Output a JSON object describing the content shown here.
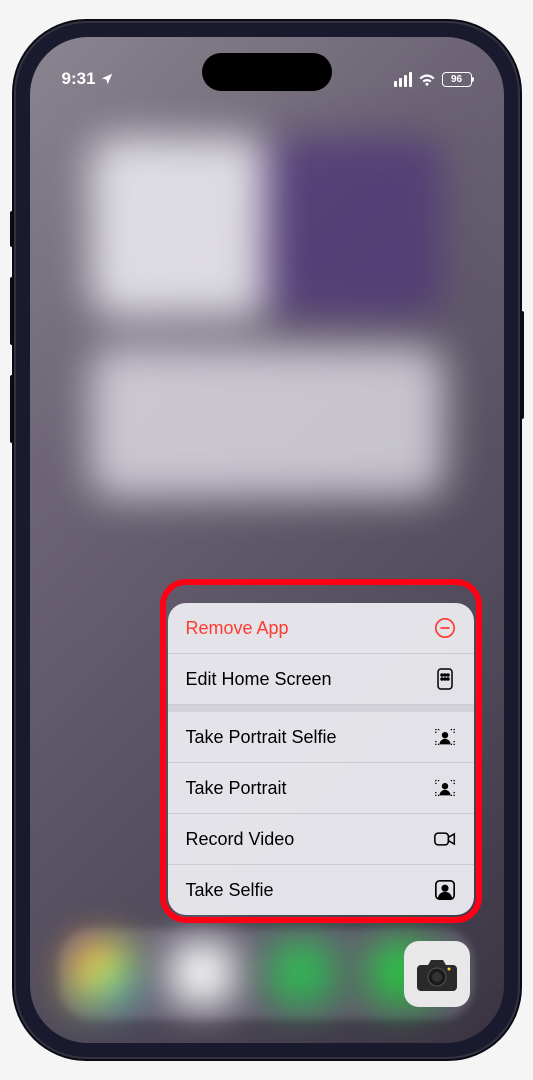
{
  "status_bar": {
    "time": "9:31",
    "battery": "96"
  },
  "context_menu": {
    "items": [
      {
        "label": "Remove App",
        "destructive": true,
        "icon": "minus-circle"
      },
      {
        "label": "Edit Home Screen",
        "icon": "apps-grid"
      },
      {
        "label": "Take Portrait Selfie",
        "icon": "person-portrait"
      },
      {
        "label": "Take Portrait",
        "icon": "person-portrait"
      },
      {
        "label": "Record Video",
        "icon": "video-camera"
      },
      {
        "label": "Take Selfie",
        "icon": "person-square"
      }
    ]
  },
  "app": {
    "name": "Camera"
  }
}
